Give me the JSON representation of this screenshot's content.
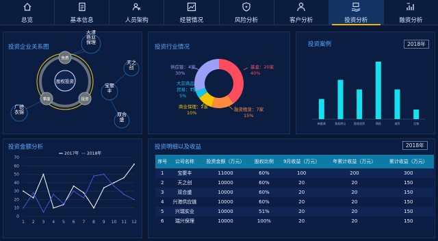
{
  "nav": {
    "items": [
      {
        "label": "总览",
        "icon": "home-icon"
      },
      {
        "label": "基本信息",
        "icon": "document-icon"
      },
      {
        "label": "人员架构",
        "icon": "user-group-icon"
      },
      {
        "label": "经营情况",
        "icon": "line-chart-icon"
      },
      {
        "label": "风险分析",
        "icon": "shield-icon"
      },
      {
        "label": "客户分析",
        "icon": "person-icon"
      },
      {
        "label": "投资分析",
        "icon": "money-hand-icon"
      },
      {
        "label": "融资分析",
        "icon": "bar-finance-icon"
      }
    ],
    "active_index": 6,
    "active_color": "#f5b700"
  },
  "panels": {
    "relation": {
      "title": "投资企业关系图",
      "center": "股权投资",
      "inner_nodes": [
        "免费",
        "季度",
        "投资"
      ],
      "outer_nodes": [
        "天津商业保理",
        "天之创",
        "宝聚丰",
        "双合盛",
        "广德衣锦"
      ]
    },
    "industry": {
      "title": "投资行业情况",
      "labels": [
        "基金：20家",
        "40%",
        "融资租赁：7家",
        "15%",
        "商业保理：2家",
        "10%",
        "大宗商品",
        "贸易：1家",
        "5%",
        "供应链：4家",
        "30%"
      ]
    },
    "cases": {
      "title": "投资案例",
      "year": "2018年"
    },
    "amount": {
      "title": "投资金额分析",
      "legend": [
        "2017年",
        "2018年"
      ]
    },
    "detail": {
      "title": "投资明细以及收益",
      "year": "2018年"
    }
  },
  "table": {
    "headers": [
      "序号",
      "公司名称",
      "投资金额（万元）",
      "股权比例",
      "9月收益（万元）",
      "年累计收益（万元）",
      "累计收益（万元）"
    ],
    "rows": [
      [
        "1",
        "宝聚丰",
        "11000",
        "60%",
        "100",
        "200",
        "300"
      ],
      [
        "2",
        "天之创",
        "10000",
        "60%",
        "20",
        "20",
        "150"
      ],
      [
        "3",
        "双合盛",
        "10000",
        "60%",
        "20",
        "20",
        "150"
      ],
      [
        "4",
        "兴港供应链",
        "10000",
        "60%",
        "20",
        "20",
        "150"
      ],
      [
        "5",
        "兴瑞实业",
        "10000",
        "51%",
        "20",
        "20",
        "150"
      ],
      [
        "6",
        "瑞兴保理",
        "10000",
        "100%",
        "20",
        "20",
        "150"
      ]
    ]
  },
  "chart_data": [
    {
      "type": "pie",
      "labels": [
        "基金",
        "融资租赁",
        "商业保理",
        "大宗商品贸易",
        "供应链"
      ],
      "values": [
        40,
        15,
        10,
        5,
        30
      ],
      "counts": [
        20,
        7,
        2,
        1,
        4
      ],
      "colors": [
        "#ff4d5e",
        "#ff8a3d",
        "#f5c400",
        "#12c4e8",
        "#9aa0f5"
      ]
    },
    {
      "type": "bar",
      "categories": [
        "新能源",
        "股权转让",
        "股权投资",
        "债权",
        "减资",
        "注销"
      ],
      "values": [
        2.1,
        4.1,
        3.1,
        6.0,
        3.1,
        1.0
      ],
      "ylim": [
        0,
        7
      ],
      "color": "#14e0f0"
    },
    {
      "type": "line",
      "x": [
        1,
        2,
        3,
        4,
        5,
        6,
        7,
        8,
        9,
        10,
        11,
        12
      ],
      "ylim": [
        0,
        70
      ],
      "yticks": [
        0,
        10,
        20,
        30,
        40,
        50,
        60,
        70
      ],
      "series": [
        {
          "name": "2017年",
          "values": [
            30,
            22,
            50,
            10,
            14,
            36,
            28,
            10,
            34,
            40,
            46,
            62
          ],
          "color": "#ffffff"
        },
        {
          "name": "2018年",
          "values": [
            10,
            28,
            5,
            26,
            15,
            30,
            22,
            48,
            50,
            36,
            26,
            20
          ],
          "color": "#3a5cd8"
        }
      ]
    }
  ]
}
